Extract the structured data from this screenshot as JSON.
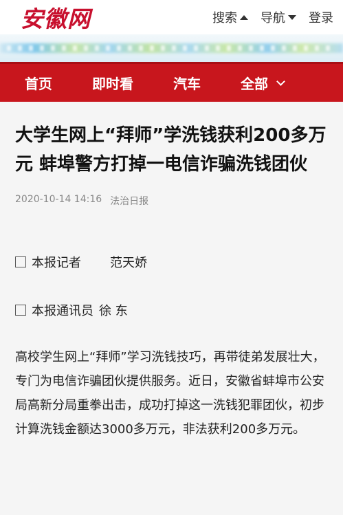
{
  "header": {
    "logo_text": "安徽网",
    "search_label": "搜索",
    "nav_label": "导航",
    "login_label": "登录"
  },
  "colors": {
    "brand_red": "#c8161d",
    "logo_red": "#c8102e",
    "meta_gray": "#888888"
  },
  "icons": {
    "search_toggle": "triangle-up-icon",
    "nav_toggle": "triangle-down-icon",
    "more": "chevron-down-icon",
    "byline_marker": "empty-box-icon"
  },
  "navbar": {
    "items": [
      {
        "label": "首页"
      },
      {
        "label": "即时看"
      },
      {
        "label": "汽车"
      },
      {
        "label": "全部"
      }
    ]
  },
  "article": {
    "title": "大学生网上“拜师”学洗钱获利200多万元 蚌埠警方打掉一电信诈骗洗钱团伙",
    "date": "2020-10-14 14:16",
    "source": "法治日报",
    "byline1_role": "本报记者",
    "byline1_name": "范天娇",
    "byline2_role": "本报通讯员",
    "byline2_name": "徐 东",
    "paragraph1": "高校学生网上“拜师”学习洗钱技巧，再带徒弟发展壮大，专门为电信诈骗团伙提供服务。近日，安徽省蚌埠市公安局高新分局重拳出击，成功打掉这一洗钱犯罪团伙，初步计算洗钱金额达3000多万元，非法获利200多万元。"
  }
}
